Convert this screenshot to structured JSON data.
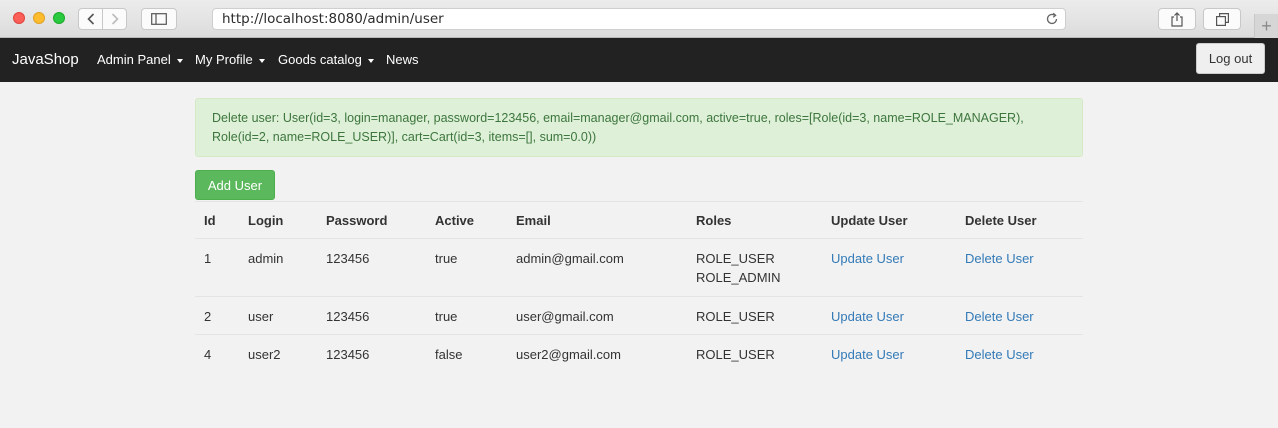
{
  "browser": {
    "url": "http://localhost:8080/admin/user"
  },
  "navbar": {
    "brand": "JavaShop",
    "items": [
      {
        "label": "Admin Panel",
        "dropdown": true
      },
      {
        "label": "My Profile",
        "dropdown": true
      },
      {
        "label": "Goods catalog",
        "dropdown": true
      },
      {
        "label": "News",
        "dropdown": false
      }
    ],
    "logout_label": "Log out"
  },
  "alert": {
    "text": "Delete user: User(id=3, login=manager, password=123456, email=manager@gmail.com, active=true, roles=[Role(id=3, name=ROLE_MANAGER), Role(id=2, name=ROLE_USER)], cart=Cart(id=3, items=[], sum=0.0))",
    "color": "#dff0d8"
  },
  "add_user_label": "Add User",
  "table": {
    "headers": [
      "Id",
      "Login",
      "Password",
      "Active",
      "Email",
      "Roles",
      "Update User",
      "Delete User"
    ],
    "rows": [
      {
        "id": "1",
        "login": "admin",
        "password": "123456",
        "active": "true",
        "email": "admin@gmail.com",
        "roles": [
          "ROLE_USER",
          "ROLE_ADMIN"
        ],
        "update": "Update User",
        "delete": "Delete User"
      },
      {
        "id": "2",
        "login": "user",
        "password": "123456",
        "active": "true",
        "email": "user@gmail.com",
        "roles": [
          "ROLE_USER"
        ],
        "update": "Update User",
        "delete": "Delete User"
      },
      {
        "id": "4",
        "login": "user2",
        "password": "123456",
        "active": "false",
        "email": "user2@gmail.com",
        "roles": [
          "ROLE_USER"
        ],
        "update": "Update User",
        "delete": "Delete User"
      }
    ]
  },
  "colors": {
    "navbar": "#222222",
    "success": "#5cb85c",
    "link": "#337ab7"
  }
}
